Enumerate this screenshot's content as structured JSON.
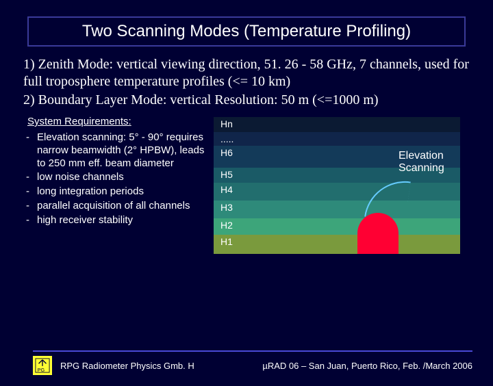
{
  "title": "Two Scanning Modes (Temperature Profiling)",
  "modes": {
    "m1": "1) Zenith Mode: vertical viewing direction, 51. 26 - 58 GHz, 7 channels, used for full troposphere temperature profiles (<= 10 km)",
    "m2": "2) Boundary Layer Mode: vertical Resolution: 50 m (<=1000 m)"
  },
  "sysreq_heading": "System Requirements:",
  "requirements": {
    "r1": "Elevation scanning: 5° - 90° requires narrow beamwidth (2° HPBW), leads to 250 mm eff. beam diameter",
    "r2": "low noise channels",
    "r3": "long integration periods",
    "r4": "parallel acquisition of all channels",
    "r5": "high receiver stability"
  },
  "diagram": {
    "hn": "Hn",
    "dots": ".....",
    "h6": "H6",
    "h5": "H5",
    "h4": "H4",
    "h3": "H3",
    "h2": "H2",
    "h1": "H1",
    "elev_label_l1": "Elevation",
    "elev_label_l2": "Scanning"
  },
  "footer": {
    "company": "RPG Radiometer Physics Gmb. H",
    "conference": "µRAD 06  – San Juan, Puerto Rico,  Feb. /March  2006"
  }
}
